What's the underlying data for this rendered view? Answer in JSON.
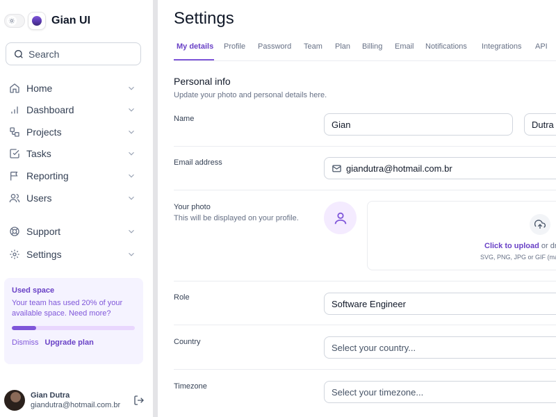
{
  "brand": {
    "name": "Gian UI"
  },
  "search": {
    "placeholder": "Search"
  },
  "nav": [
    {
      "label": "Home",
      "icon": "home-icon"
    },
    {
      "label": "Dashboard",
      "icon": "bar-chart-icon"
    },
    {
      "label": "Projects",
      "icon": "layers-icon"
    },
    {
      "label": "Tasks",
      "icon": "check-square-icon"
    },
    {
      "label": "Reporting",
      "icon": "flag-icon"
    },
    {
      "label": "Users",
      "icon": "users-icon"
    },
    {
      "label": "Support",
      "icon": "life-buoy-icon"
    },
    {
      "label": "Settings",
      "icon": "gear-icon"
    }
  ],
  "usage": {
    "title": "Used space",
    "description": "Your team has used 20% of your available space. Need more?",
    "percent": 20,
    "dismiss": "Dismiss",
    "upgrade": "Upgrade plan"
  },
  "user": {
    "name": "Gian Dutra",
    "email": "giandutra@hotmail.com.br"
  },
  "page": {
    "title": "Settings"
  },
  "tabs": [
    "My details",
    "Profile",
    "Password",
    "Team",
    "Plan",
    "Billing",
    "Email",
    "Notifications",
    "Integrations",
    "API"
  ],
  "active_tab": 0,
  "section": {
    "title": "Personal info",
    "subtitle": "Update your photo and personal details here."
  },
  "form": {
    "name_label": "Name",
    "first_name": "Gian",
    "last_name": "Dutra",
    "email_label": "Email address",
    "email": "giandutra@hotmail.com.br",
    "photo_label": "Your photo",
    "photo_sub": "This will be displayed on your profile.",
    "upload_click": "Click to upload",
    "upload_or": " or dra",
    "upload_types": "SVG, PNG, JPG or GIF (ma",
    "role_label": "Role",
    "role": "Software Engineer",
    "country_label": "Country",
    "country_placeholder": "Select your country...",
    "timezone_label": "Timezone",
    "timezone_placeholder": "Select your timezone..."
  },
  "colors": {
    "accent": "#7f56d9",
    "accent_dark": "#6941c6",
    "border": "#d0d5dd"
  }
}
